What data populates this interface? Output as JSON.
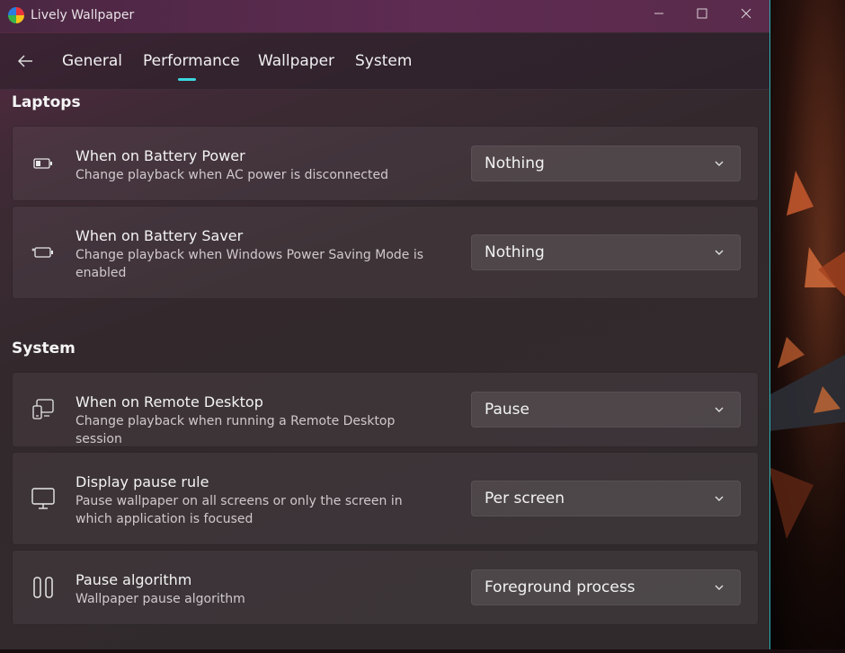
{
  "window": {
    "title": "Lively Wallpaper",
    "minimize_icon": "minimize-icon",
    "maximize_icon": "maximize-icon",
    "close_icon": "close-icon"
  },
  "nav": {
    "back_icon": "back-arrow-icon",
    "tabs": [
      {
        "label": "General",
        "selected": false
      },
      {
        "label": "Performance",
        "selected": true
      },
      {
        "label": "Wallpaper",
        "selected": false
      },
      {
        "label": "System",
        "selected": false
      }
    ],
    "accent_color": "#3cd7e0"
  },
  "sections": [
    {
      "title": "Laptops",
      "cards": [
        {
          "icon": "battery-icon",
          "title": "When on Battery Power",
          "description": "Change playback when AC power is disconnected",
          "value": "Nothing"
        },
        {
          "icon": "battery-saver-icon",
          "title": "When on Battery Saver",
          "description": "Change playback when Windows Power Saving Mode is enabled",
          "value": "Nothing"
        }
      ]
    },
    {
      "title": "System",
      "cards": [
        {
          "icon": "remote-desktop-icon",
          "title": "When on Remote Desktop",
          "description": "Change playback when running a Remote Desktop session",
          "value": "Pause"
        },
        {
          "icon": "monitor-icon",
          "title": "Display pause rule",
          "description": "Pause wallpaper on all screens or only the screen in which application is focused",
          "value": "Per screen"
        },
        {
          "icon": "pause-icon",
          "title": "Pause algorithm",
          "description": "Wallpaper pause algorithm",
          "value": "Foreground process"
        }
      ]
    }
  ]
}
